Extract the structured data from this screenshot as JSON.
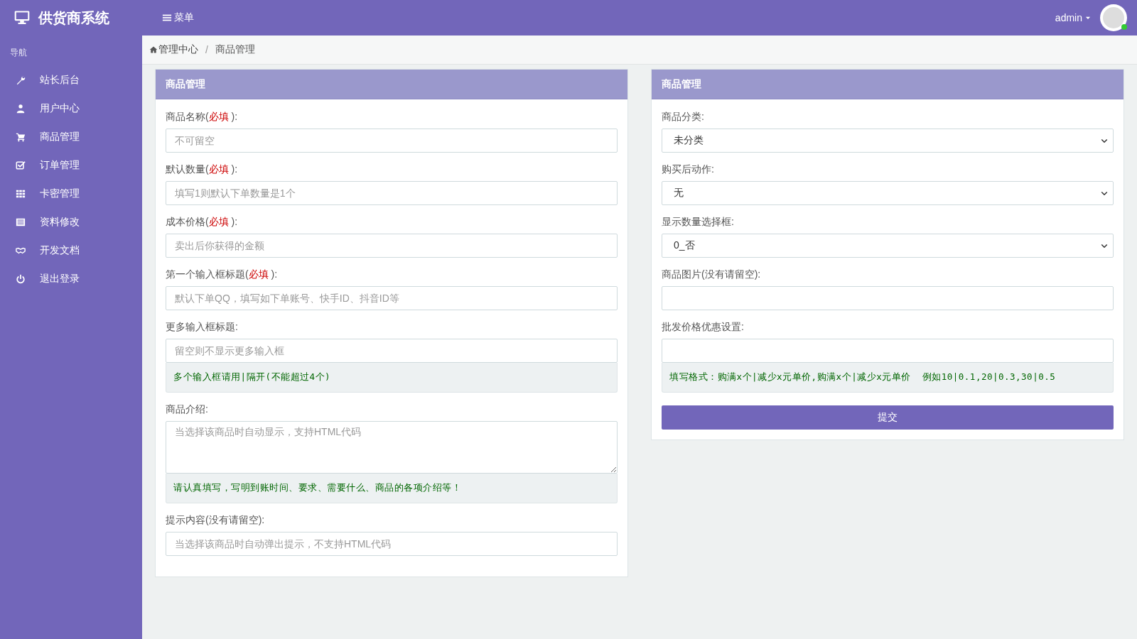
{
  "brand": {
    "title": "供货商系统"
  },
  "top_bar": {
    "menu_label": "菜单",
    "user": "admin"
  },
  "sidebar": {
    "heading": "导航",
    "items": [
      {
        "label": "站长后台",
        "selected": false
      },
      {
        "label": "用户中心",
        "selected": false
      },
      {
        "label": "商品管理",
        "selected": false
      },
      {
        "label": "订单管理",
        "selected": false
      },
      {
        "label": "卡密管理",
        "selected": false
      },
      {
        "label": "资料修改",
        "selected": false
      },
      {
        "label": "开发文档",
        "selected": false
      },
      {
        "label": "退出登录",
        "selected": false
      }
    ]
  },
  "breadcrumb": {
    "items": [
      "管理中心",
      "商品管理"
    ],
    "separator": "/"
  },
  "panels": [
    {
      "title": "商品管理",
      "fields": [
        {
          "kind": "input",
          "label": "商品名称(",
          "required": "必填",
          "label_end": " ):",
          "placeholder": "不可留空"
        },
        {
          "kind": "input",
          "label": "默认数量(",
          "required": "必填",
          "label_end": " ):",
          "placeholder": "填写1则默认下单数量是1个"
        },
        {
          "kind": "input",
          "label": "成本价格(",
          "required": "必填",
          "label_end": " ):",
          "placeholder": "卖出后你获得的金额"
        },
        {
          "kind": "input",
          "label": "第一个输入框标题(",
          "required": "必填",
          "label_end": " ):",
          "placeholder": "默认下单QQ，填写如下单账号、快手ID、抖音ID等"
        },
        {
          "kind": "input",
          "label": "更多输入框标题:",
          "placeholder": "留空则不显示更多输入框",
          "help": "多个输入框请用|隔开(不能超过4个)"
        },
        {
          "kind": "textarea",
          "label": "商品介绍:",
          "placeholder": "当选择该商品时自动显示，支持HTML代码",
          "help": "请认真填写，写明到账时间、要求、需要什么、商品的各项介绍等！"
        },
        {
          "kind": "input",
          "label": "提示内容(没有请留空):",
          "placeholder": "当选择该商品时自动弹出提示，不支持HTML代码"
        }
      ]
    },
    {
      "title": "商品管理",
      "fields": [
        {
          "kind": "select",
          "label": "商品分类:",
          "value": "未分类"
        },
        {
          "kind": "select",
          "label": "购买后动作:",
          "value": "无"
        },
        {
          "kind": "select",
          "label": "显示数量选择框:",
          "value": "0_否"
        },
        {
          "kind": "input",
          "label": "商品图片(没有请留空):"
        },
        {
          "kind": "input",
          "label": "批发价格优惠设置:",
          "help": "填写格式：购满x个|减少x元单价,购满x个|减少x元单价  例如10|0.1,20|0.3,30|0.5"
        }
      ],
      "submit": "提交"
    }
  ]
}
